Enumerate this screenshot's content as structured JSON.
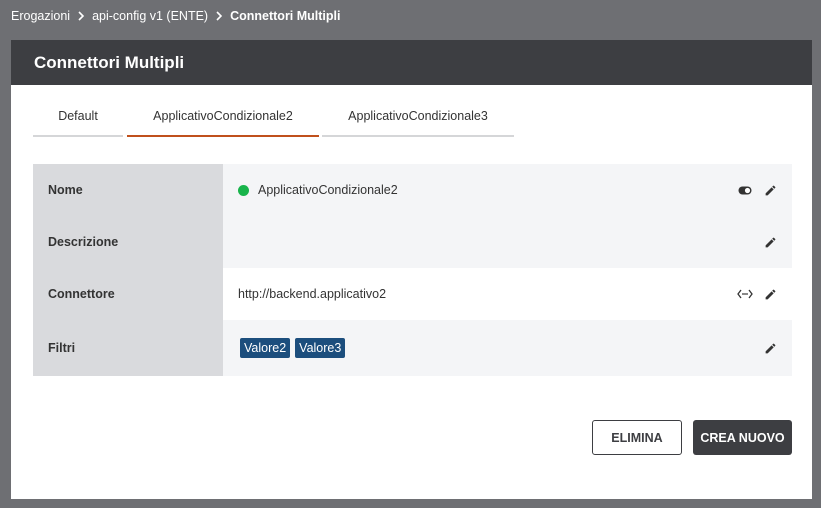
{
  "breadcrumb": {
    "items": [
      "Erogazioni",
      "api-config v1 (ENTE)"
    ],
    "current": "Connettori Multipli"
  },
  "card": {
    "title": "Connettori Multipli"
  },
  "tabs": [
    {
      "label": "Default"
    },
    {
      "label": "ApplicativoCondizionale2",
      "active": true
    },
    {
      "label": "ApplicativoCondizionale3"
    }
  ],
  "rows": {
    "nome": {
      "label": "Nome",
      "value": "ApplicativoCondizionale2",
      "status_color": "#18b44b"
    },
    "descrizione": {
      "label": "Descrizione",
      "value": ""
    },
    "connettore": {
      "label": "Connettore",
      "value": "http://backend.applicativo2"
    },
    "filtri": {
      "label": "Filtri",
      "tags": [
        "Valore2",
        "Valore3"
      ]
    }
  },
  "buttons": {
    "delete": "ELIMINA",
    "create": "CREA NUOVO"
  },
  "icons": [
    "chevron-right-icon",
    "toggle-icon",
    "edit-icon",
    "code-icon"
  ],
  "colors": {
    "header": "#3d3e42",
    "active_tab": "#c0501c",
    "tag": "#1c4e7d",
    "status_ok": "#18b44b"
  }
}
